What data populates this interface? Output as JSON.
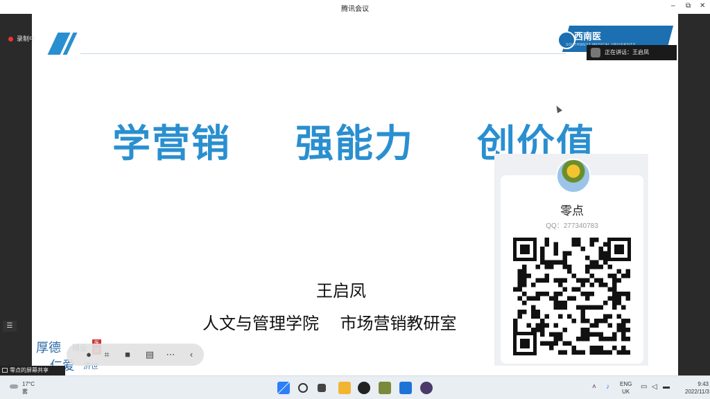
{
  "window": {
    "title": "腾讯会议",
    "controls": {
      "minimize": "–",
      "restore": "⧉",
      "close": "✕"
    }
  },
  "recording": {
    "label": "录制中"
  },
  "speaking": {
    "label": "正在讲话：王启凤"
  },
  "slide": {
    "logo": {
      "name": "西南医",
      "sub": "SOUTHWEST MEDICAL UNIVERSITY"
    },
    "slogans": [
      "学营销",
      "强能力",
      "创价值"
    ],
    "author": "王启凤",
    "department": "人文与管理学院    市场营销教研室",
    "card": {
      "name": "零点",
      "qq": "QQ：277340783"
    },
    "watermark": {
      "line1": "厚德",
      "line1b": "精业",
      "line2": "仁爱",
      "line2b": "济世",
      "seal": "医训"
    }
  },
  "share_label": "零点的屏幕共享",
  "toolbar": {
    "icons": [
      "video-icon",
      "screenshot-icon",
      "camera-icon",
      "chat-icon",
      "more-icon",
      "collapse-icon"
    ]
  },
  "taskbar": {
    "weather": {
      "temp": "17°C",
      "desc": "雾"
    },
    "language": {
      "line1": "ENG",
      "line2": "UK"
    },
    "clock": {
      "time": "9:43",
      "date": "2022/11/3"
    }
  },
  "colors": {
    "accent": "#2a8fd0",
    "brand": "#1c6fb0"
  }
}
